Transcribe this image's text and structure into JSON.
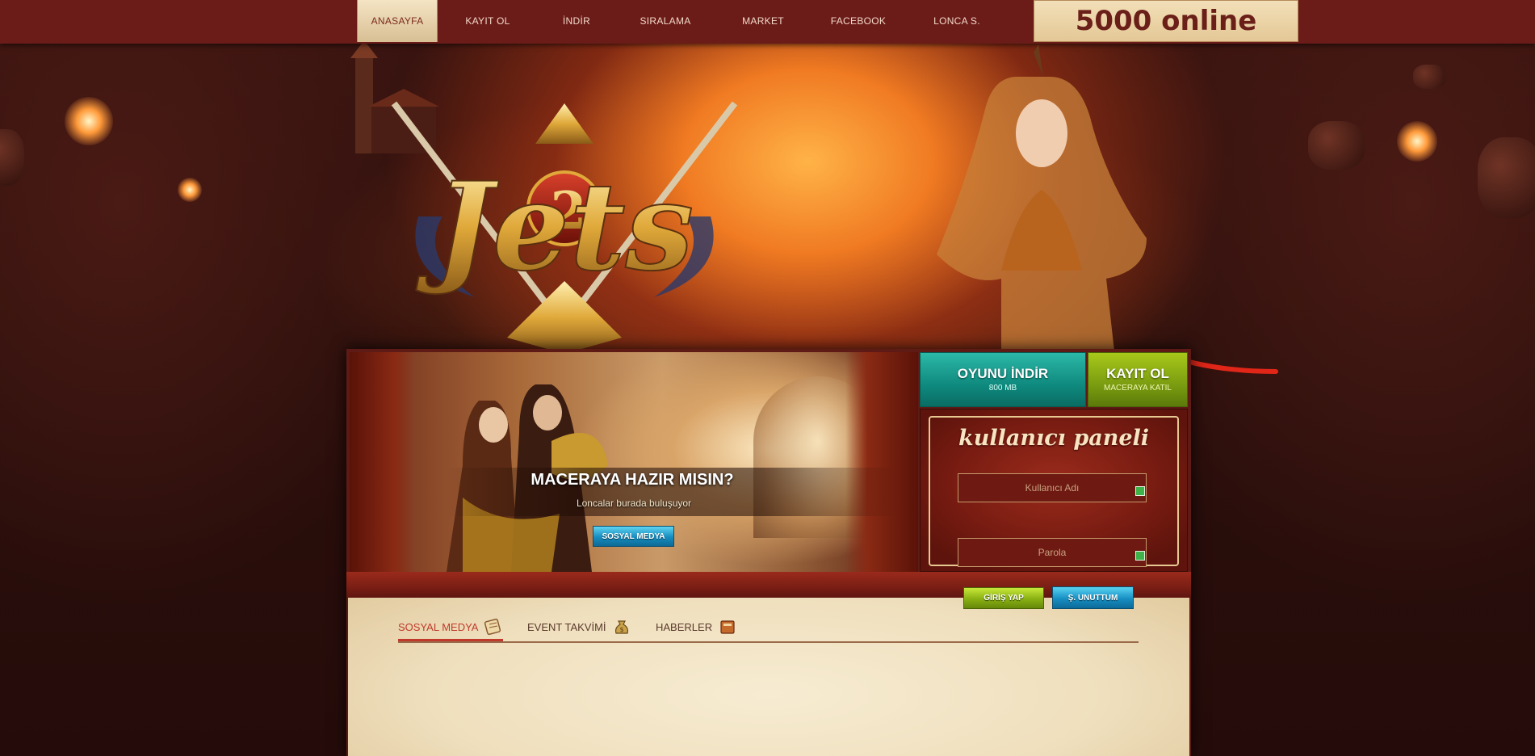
{
  "nav": {
    "items": [
      {
        "label": "ANASAYFA",
        "active": true
      },
      {
        "label": "KAYIT OL",
        "active": false
      },
      {
        "label": "İNDİR",
        "active": false
      },
      {
        "label": "SIRALAMA",
        "active": false
      },
      {
        "label": "MARKET",
        "active": false
      },
      {
        "label": "FACEBOOK",
        "active": false
      },
      {
        "label": "LONCA S.",
        "active": false
      }
    ],
    "online_status": "5000 online"
  },
  "logo": {
    "text": "Jets",
    "number": "2"
  },
  "banner": {
    "title": "MACERAYA HAZIR MISIN?",
    "subtitle": "Loncalar burada buluşuyor",
    "button_label": "SOSYAL MEDYA"
  },
  "actions": {
    "download": {
      "title": "OYUNU İNDİR",
      "subtitle": "800 MB"
    },
    "register": {
      "title": "KAYIT OL",
      "subtitle": "MACERAYA KATIL"
    }
  },
  "user_panel": {
    "title": "kullanıcı paneli",
    "username_placeholder": "Kullanıcı Adı",
    "password_placeholder": "Parola",
    "login_label": "GİRİŞ YAP",
    "forgot_label": "Ş. UNUTTUM"
  },
  "tabs": [
    {
      "label": "SOSYAL MEDYA",
      "icon": "scroll-icon",
      "active": true
    },
    {
      "label": "EVENT TAKVİMİ",
      "icon": "money-bag-icon",
      "active": false
    },
    {
      "label": "HABERLER",
      "icon": "book-icon",
      "active": false
    }
  ],
  "colors": {
    "nav_bg": "#6b1c19",
    "accent_red": "#c0392b",
    "teal": "#0f8a7e",
    "lime": "#7a9c10",
    "blue": "#168cbf",
    "parchment": "#efdfbd"
  }
}
